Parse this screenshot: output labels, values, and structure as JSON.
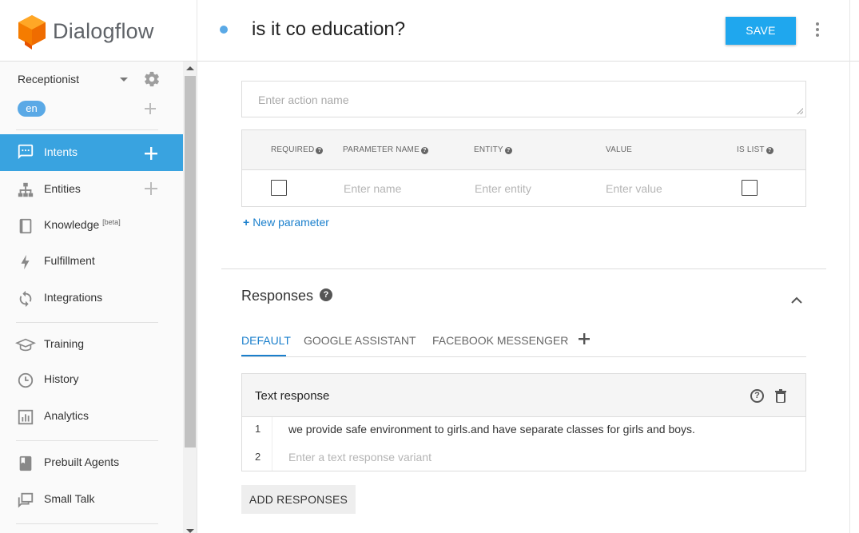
{
  "app": {
    "name": "Dialogflow",
    "brand_color": "#ef6c00"
  },
  "sidebar": {
    "agent_name": "Receptionist",
    "language": "en",
    "items": [
      {
        "label": "Intents",
        "icon": "chat-icon",
        "active": true,
        "has_add": true
      },
      {
        "label": "Entities",
        "icon": "hierarchy-icon",
        "active": false,
        "has_add": true
      },
      {
        "label": "Knowledge",
        "suffix": "[beta]",
        "icon": "book-icon",
        "active": false
      },
      {
        "label": "Fulfillment",
        "icon": "bolt-icon",
        "active": false
      },
      {
        "label": "Integrations",
        "icon": "sync-icon",
        "active": false
      },
      {
        "label": "Training",
        "icon": "graduation-cap-icon",
        "active": false
      },
      {
        "label": "History",
        "icon": "clock-icon",
        "active": false
      },
      {
        "label": "Analytics",
        "icon": "bar-chart-icon",
        "active": false
      },
      {
        "label": "Prebuilt Agents",
        "icon": "bookmark-book-icon",
        "active": false
      },
      {
        "label": "Small Talk",
        "icon": "chat-bubbles-icon",
        "active": false
      }
    ],
    "active_color": "#39a3e0"
  },
  "header": {
    "intent_title": "is it co education?",
    "save_label": "SAVE"
  },
  "action": {
    "placeholder": "Enter action name"
  },
  "parameters": {
    "columns": [
      "REQUIRED",
      "PARAMETER NAME",
      "ENTITY",
      "VALUE",
      "IS LIST"
    ],
    "row_placeholders": {
      "name": "Enter name",
      "entity": "Enter entity",
      "value": "Enter value"
    },
    "new_parameter_label": "New parameter"
  },
  "responses": {
    "title": "Responses",
    "tabs": [
      "DEFAULT",
      "GOOGLE ASSISTANT",
      "FACEBOOK MESSENGER"
    ],
    "active_tab": "DEFAULT",
    "text_response": {
      "title": "Text response",
      "lines": [
        {
          "num": "1",
          "text": "we provide safe environment to girls.and have separate classes for girls and boys."
        },
        {
          "num": "2",
          "placeholder": "Enter a text response variant"
        }
      ]
    },
    "add_label": "ADD RESPONSES"
  }
}
